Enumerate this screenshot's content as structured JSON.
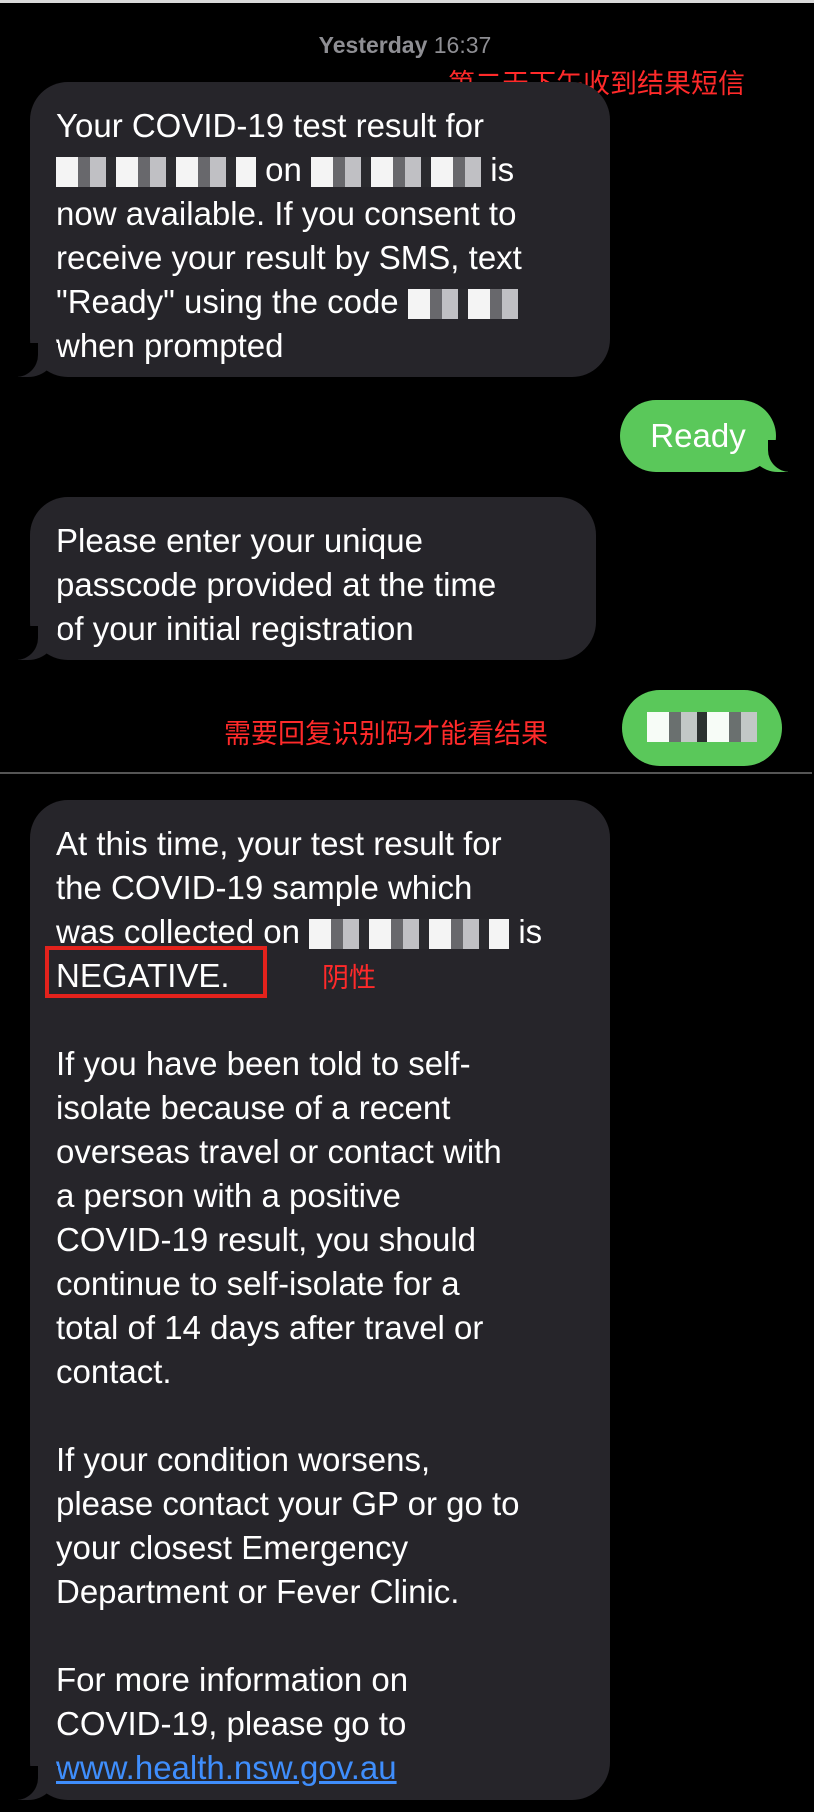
{
  "header": {
    "day": "Yesterday",
    "time": "16:37"
  },
  "annotations": {
    "next_day": "第二天下午收到结果短信",
    "reply_code": "需要回复识别码才能看结果",
    "negative": "阴性"
  },
  "messages": {
    "m1": {
      "l1": "Your COVID-19 test result for",
      "l2a": "on",
      "l2b": "is",
      "l3": "now available. If you consent to",
      "l4": "receive your result by SMS, text",
      "l5": "\"Ready\" using the code",
      "l6": "when prompted"
    },
    "reply1": "Ready",
    "m2": {
      "l1": "Please enter your unique",
      "l2": "passcode provided at the time",
      "l3": "of your initial registration"
    },
    "m3": {
      "l1": "At this time, your test result for",
      "l2": "the COVID-19 sample which",
      "l3a": "was collected on",
      "l3b": "is",
      "l4": "NEGATIVE.",
      "p2": [
        "If you have been told to self-",
        "isolate because of a recent",
        "overseas travel or contact with",
        "a person with a positive",
        "COVID-19 result, you should",
        "continue to self-isolate for a",
        "total of 14 days after travel or",
        "contact."
      ],
      "p3": [
        "If your condition worsens,",
        "please contact your GP or go to",
        "your closest Emergency",
        "Department or Fever Clinic."
      ],
      "p4": [
        "For more information on",
        "COVID-19, please go to"
      ],
      "link": "www.health.nsw.gov.au"
    }
  },
  "colors": {
    "incoming_bubble": "#26252a",
    "outgoing_bubble": "#5ac85a",
    "annotation": "#ff2a2a",
    "link": "#3f8efc"
  }
}
